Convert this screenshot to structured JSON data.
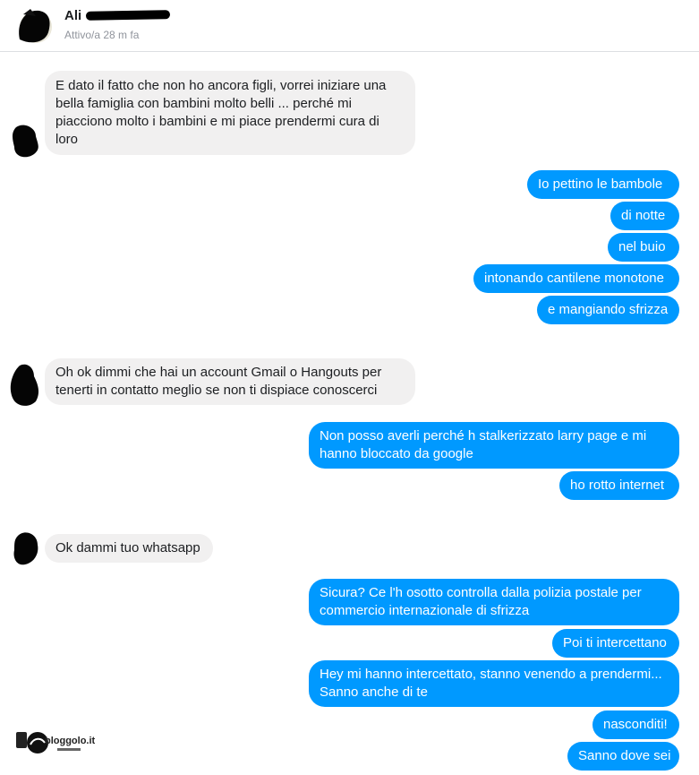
{
  "header": {
    "name": "Ali",
    "status": "Attivo/a 28 m fa"
  },
  "messages": {
    "m1": "E dato il fatto che non ho ancora figli, vorrei iniziare una bella famiglia con bambini molto belli ... perché mi piacciono molto i bambini e mi piace prendermi cura di loro",
    "m2": "Io pettino le bambole",
    "m3": "di notte",
    "m4": "nel buio",
    "m5": "intonando cantilene monotone",
    "m6": "e mangiando sfrizza",
    "m7": "Oh ok dimmi che hai un account Gmail o Hangouts per tenerti in contatto meglio se non ti dispiace conoscerci",
    "m8": "Non posso averli perché h stalkerizzato larry page e mi hanno bloccato da google",
    "m9": "ho rotto internet",
    "m10": "Ok dammi tuo whatsapp",
    "m11": "Sicura? Ce l'h osotto controlla dalla polizia postale per commercio internazionale di sfrizza",
    "m12": "Poi ti intercettano",
    "m13": "Hey mi hanno intercettato, stanno venendo a prendermi... Sanno anche di te",
    "m14": "nasconditi!",
    "m15": "Sanno dove sei"
  },
  "watermark": {
    "text": "bloggolo.it"
  },
  "colors": {
    "outgoing": "#0099ff",
    "incoming": "#f1f0f0"
  }
}
